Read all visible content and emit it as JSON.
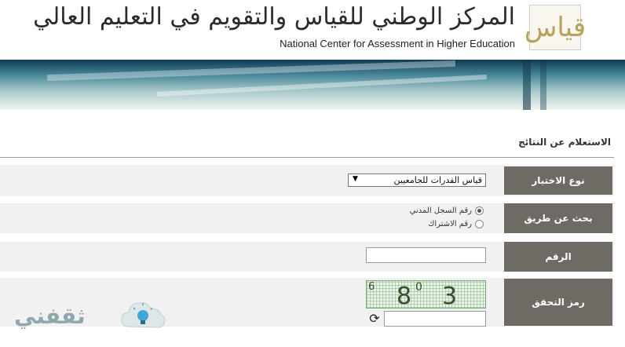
{
  "header": {
    "title_ar": "المركز الوطني للقياس والتقويم في التعليم العالي",
    "title_en": "National Center for Assessment in Higher Education",
    "logo_text": "قياس"
  },
  "form": {
    "section_title": "الاستعلام عن النتائج",
    "exam_type": {
      "label": "نوع الاختبار",
      "selected": "قياس القدرات للجامعيين",
      "arrow": "▼"
    },
    "search_by": {
      "label": "بحث عن طريق",
      "options": [
        {
          "label": "رقم السجل المدني",
          "checked": true
        },
        {
          "label": "رقم الاشتراك",
          "checked": false
        }
      ]
    },
    "number": {
      "label": "الرقم",
      "value": ""
    },
    "captcha": {
      "label": "رمز التحقق",
      "chars": [
        "6",
        "8",
        "0",
        "3"
      ],
      "input_value": "",
      "refresh_icon": "refresh-icon"
    }
  },
  "watermark": {
    "text": "ثقفني",
    "icon": "lightbulb-cloud-icon"
  },
  "colors": {
    "label_bg": "#6e6b64",
    "row_bg": "#f1f1f1",
    "banner_dark": "#0f3b57",
    "logo_gold": "#b8a25c"
  }
}
